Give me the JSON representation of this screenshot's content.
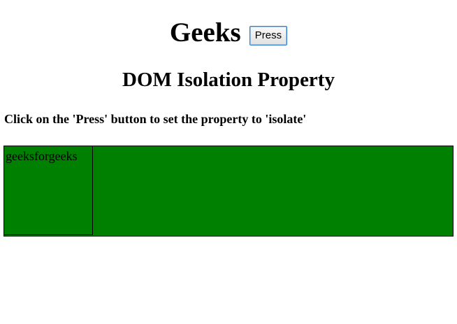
{
  "header": {
    "title": "Geeks",
    "button_label": "Press"
  },
  "section": {
    "title": "DOM Isolation Property"
  },
  "instruction": {
    "text": "Click on the 'Press' button to set the property to 'isolate'"
  },
  "demo": {
    "inner_text": "geeksforgeeks",
    "box_color": "#008000",
    "border_color": "#000000"
  },
  "colors": {
    "button_focus_border": "#2f7fd6"
  }
}
